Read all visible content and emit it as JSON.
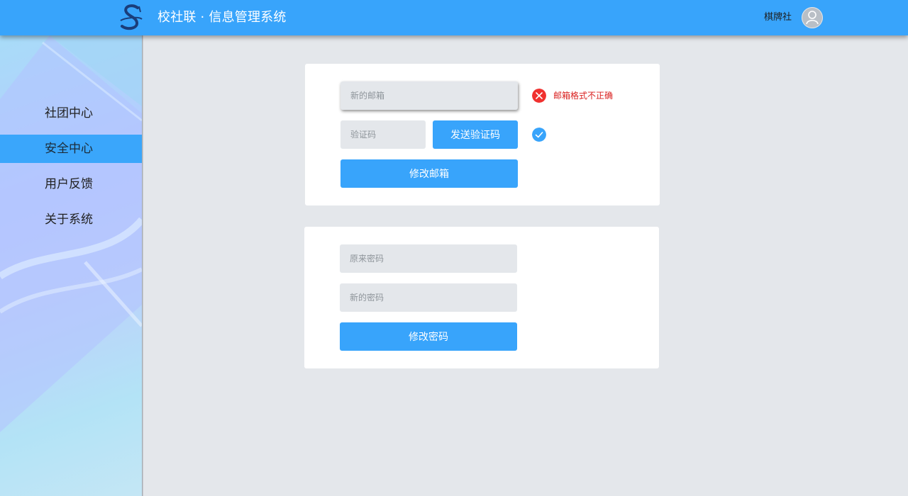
{
  "app": {
    "title": "校社联 · 信息管理系统",
    "user_name": "棋牌社",
    "logo_icon": "s-logo-icon",
    "avatar_icon": "user-avatar-icon"
  },
  "sidebar": {
    "items": [
      {
        "label": "社团中心",
        "active": false
      },
      {
        "label": "安全中心",
        "active": true
      },
      {
        "label": "用户反馈",
        "active": false
      },
      {
        "label": "关于系统",
        "active": false
      }
    ]
  },
  "email_form": {
    "new_email_placeholder": "新的邮箱",
    "new_email_value": "",
    "email_error": "邮箱格式不正确",
    "code_placeholder": "验证码",
    "code_value": "",
    "send_code_label": "发送验证码",
    "submit_label": "修改邮箱",
    "error_icon": "error-x-icon",
    "ok_icon": "check-icon"
  },
  "password_form": {
    "old_password_placeholder": "原来密码",
    "new_password_placeholder": "新的密码",
    "submit_label": "修改密码"
  },
  "colors": {
    "accent": "#38a4fb",
    "error": "#f0312f",
    "error_text": "#d9201f",
    "background": "#e4e7eb"
  }
}
